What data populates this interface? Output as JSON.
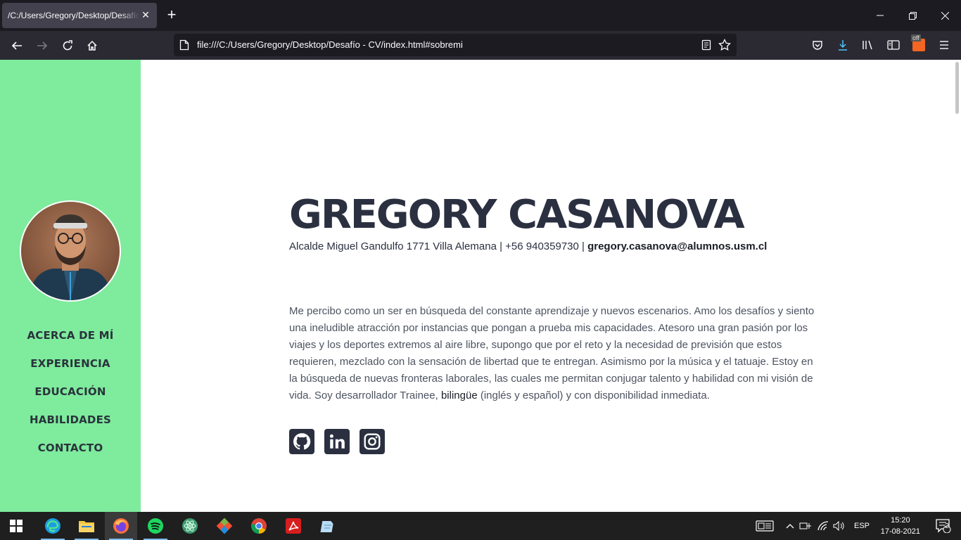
{
  "browser": {
    "tab_title": "/C:/Users/Gregory/Desktop/Desafío - CV/index.html#sobremi",
    "tab_close": "✕",
    "new_tab": "+",
    "url": "file:///C:/Users/Gregory/Desktop/Desafío - CV/index.html#sobremi",
    "addon_badge": "off"
  },
  "sidebar": {
    "bg_color": "#7eeb9d",
    "menu": [
      {
        "label": "ACERCA DE MÍ"
      },
      {
        "label": "EXPERIENCIA"
      },
      {
        "label": "EDUCACIÓN"
      },
      {
        "label": "HABILIDADES"
      },
      {
        "label": "CONTACTO"
      }
    ]
  },
  "profile": {
    "name": "GREGORY CASANOVA",
    "address_phone": "Alcalde Miguel Gandulfo 1771 Villa Alemana | +56 940359730 | ",
    "email": "gregory.casanova@alumnos.usm.cl",
    "about_part1": "Me percibo como un ser en búsqueda del constante aprendizaje y nuevos escenarios. Amo los desafíos y siento una ineludible atracción por instancias que pongan a prueba mis capacidades. Atesoro una gran pasión por los viajes y los deportes extremos al aire libre, supongo que por el reto y la necesidad de previsión que estos requieren, mezclado con la sensación de libertad que te entregan. Asimismo por la música y el tatuaje. Estoy en la búsqueda de nuevas fronteras laborales, las cuales me permitan conjugar talento y habilidad con mi visión de vida. Soy desarrollador Trainee, ",
    "about_strong": "bilingüe",
    "about_part2": " (inglés y español) y con disponibilidad inmediata.",
    "socials": [
      "github-icon",
      "linkedin-icon",
      "instagram-icon"
    ]
  },
  "taskbar": {
    "language": "ESP",
    "time": "15:20",
    "date": "17-08-2021",
    "notifications": "2"
  }
}
